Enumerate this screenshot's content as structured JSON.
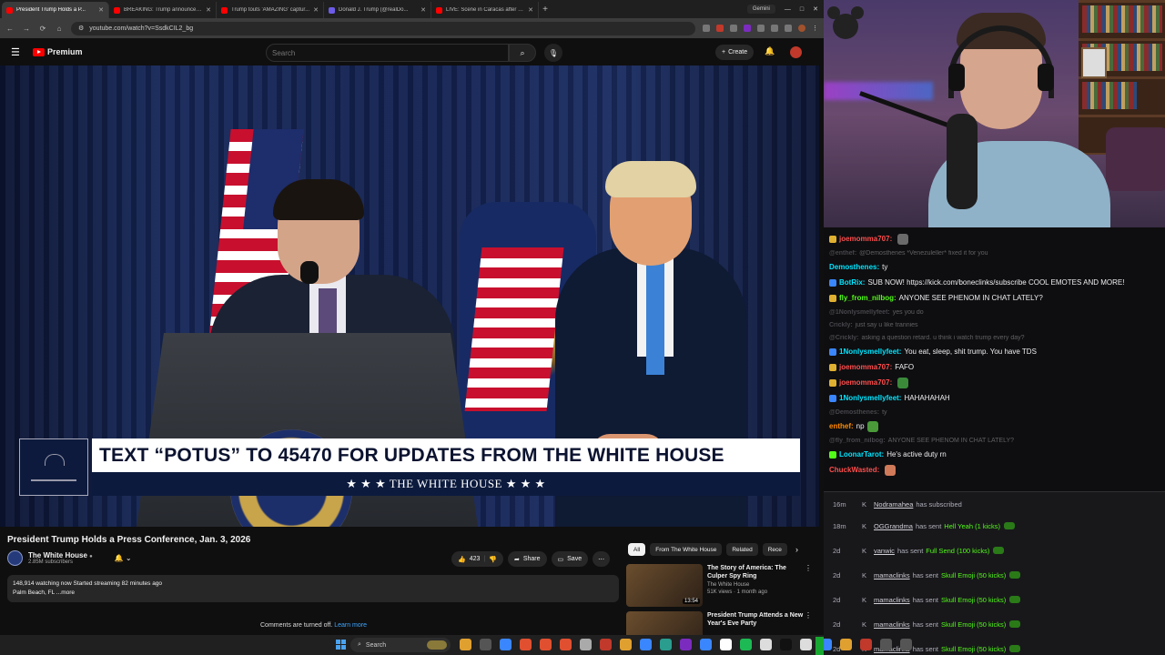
{
  "browser": {
    "tabs": [
      {
        "title": "President Trump Holds a P...",
        "color": "#ff0000",
        "active": true
      },
      {
        "title": "BREAKING: Trump announces...",
        "color": "#ff0000",
        "active": false
      },
      {
        "title": "Trump touts 'AMAZING' captur...",
        "color": "#ff0000",
        "active": false
      },
      {
        "title": "Donald J. Trump (@realDo...",
        "color": "#6c5ce7",
        "active": false
      },
      {
        "title": "LIVE: Scene in Caracas after U...",
        "color": "#ff0000",
        "active": false
      }
    ],
    "new_tab": "+",
    "gemini": "Gemini",
    "url": "youtube.com/watch?v=SsdkCIL2_bg"
  },
  "youtube": {
    "logo": "Premium",
    "search_placeholder": "Search",
    "create": "Create",
    "video_title": "President Trump Holds a Press Conference, Jan. 3, 2026",
    "channel_name": "The White House",
    "subscribers": "2.85M subscribers",
    "likes": "423",
    "share": "Share",
    "save": "Save",
    "desc_line1": "148,914 watching now  Started streaming 82 minutes ago",
    "desc_line2": "Palm Beach, FL ...more",
    "comments_off": "Comments are turned off.",
    "learn_more": "Learn more",
    "chips": [
      "All",
      "From The White House",
      "Related",
      "Rece"
    ],
    "recs": [
      {
        "title": "The Story of America: The Culper Spy Ring",
        "channel": "The White House",
        "meta": "51K views · 1 month ago",
        "duration": "13:54"
      },
      {
        "title": "President Trump Attends a New Year's Eve Party",
        "channel": "",
        "meta": "",
        "duration": ""
      }
    ],
    "lower_third_headline": "TEXT “POTUS” TO 45470 FOR UPDATES FROM THE WHITE HOUSE",
    "lower_third_brand": "★ ★ ★  THE WHITE HOUSE  ★ ★ ★"
  },
  "chat": [
    {
      "user": "joemomma707:",
      "text": "",
      "user_color": "#ff4d4d",
      "badge": "#e0b030",
      "emote": "#6a6a6a",
      "dim": false
    },
    {
      "user": "@enthef:",
      "text": "@Demosthenes *Venezuleller* fixed it for you",
      "user_color": "#adadb8",
      "badge": "",
      "emote": "",
      "dim": true
    },
    {
      "user": "Demosthenes:",
      "text": "ty",
      "user_color": "#00e5ff",
      "badge": "",
      "emote": "",
      "dim": false
    },
    {
      "user": "BotRix:",
      "text": "SUB NOW! https://kick.com/boneclinks/subscribe COOL EMOTES AND MORE!",
      "user_color": "#00e5ff",
      "badge": "#3a86ff",
      "emote": "",
      "dim": false
    },
    {
      "user": "fly_from_nilbog:",
      "text": "ANYONE SEE PHENOM IN CHAT LATELY?",
      "user_color": "#53fc18",
      "badge": "#e0b030",
      "emote": "",
      "dim": false
    },
    {
      "user": "@1Nonlysmellyfeet:",
      "text": "yes you do",
      "user_color": "#adadb8",
      "badge": "",
      "emote": "",
      "dim": true
    },
    {
      "user": "Crickly:",
      "text": "just say u like trannies",
      "user_color": "#adadb8",
      "badge": "",
      "emote": "",
      "dim": true
    },
    {
      "user": "@Crickly:",
      "text": "asking a question retard. u think i watch trump every day?",
      "user_color": "#adadb8",
      "badge": "",
      "emote": "",
      "dim": true
    },
    {
      "user": "1Nonlysmellyfeet:",
      "text": "You eat, sleep, shit trump. You have TDS",
      "user_color": "#00e5ff",
      "badge": "#3a86ff",
      "emote": "",
      "dim": false
    },
    {
      "user": "joemomma707:",
      "text": "FAFO",
      "user_color": "#ff4d4d",
      "badge": "#e0b030",
      "emote": "",
      "dim": false
    },
    {
      "user": "joemomma707:",
      "text": "",
      "user_color": "#ff4d4d",
      "badge": "#e0b030",
      "emote": "#3a8a3a",
      "dim": false
    },
    {
      "user": "1Nonlysmellyfeet:",
      "text": "HAHAHAHAH",
      "user_color": "#00e5ff",
      "badge": "#3a86ff",
      "emote": "",
      "dim": false
    },
    {
      "user": "@Demosthenes:",
      "text": "ty",
      "user_color": "#adadb8",
      "badge": "",
      "emote": "",
      "dim": true
    },
    {
      "user": "enthef:",
      "text": "np",
      "user_color": "#ff8c00",
      "badge": "",
      "emote": "#4a9a3a",
      "dim": false
    },
    {
      "user": "@fly_from_nilbog:",
      "text": "ANYONE SEE PHENOM IN CHAT LATELY?",
      "user_color": "#adadb8",
      "badge": "",
      "emote": "",
      "dim": true
    },
    {
      "user": "LoonarTarot:",
      "text": "He's active duty rn",
      "user_color": "#00e5ff",
      "badge": "#53fc18",
      "emote": "",
      "dim": false
    },
    {
      "user": "ChuckWasted:",
      "text": "",
      "user_color": "#ff4d4d",
      "badge": "",
      "emote": "#d07a5a",
      "dim": false
    }
  ],
  "events": [
    {
      "time": "16m",
      "user": "Nodramahea",
      "action": "has subscribed",
      "gift": ""
    },
    {
      "time": "18m",
      "user": "OGGrandma",
      "action": "has sent",
      "gift": "Hell Yeah (1 kicks)"
    },
    {
      "time": "2d",
      "user": "vanwic",
      "action": "has sent",
      "gift": "Full Send (100 kicks)"
    },
    {
      "time": "2d",
      "user": "mamaclinks",
      "action": "has sent",
      "gift": "Skull Emoji (50 kicks)"
    },
    {
      "time": "2d",
      "user": "mamaclinks",
      "action": "has sent",
      "gift": "Skull Emoji (50 kicks)"
    },
    {
      "time": "2d",
      "user": "mamaclinks",
      "action": "has sent",
      "gift": "Skull Emoji (50 kicks)"
    },
    {
      "time": "2d",
      "user": "mamaclinks",
      "action": "has sent",
      "gift": "Skull Emoji (50 kicks)"
    }
  ],
  "taskbar": {
    "search": "Search",
    "icons": [
      "#e0a030",
      "#555",
      "#3a86ff",
      "#e05030",
      "#e05030",
      "#e05030",
      "#aaa",
      "#c0392b",
      "#e0a030",
      "#3a86ff",
      "#2a9d8f",
      "#7b2cbf",
      "#3a86ff",
      "#fff",
      "#1db954",
      "#ddd",
      "#111",
      "#ddd",
      "#3a86ff",
      "#e0a030",
      "#c0392b",
      "#555",
      "#555"
    ]
  }
}
